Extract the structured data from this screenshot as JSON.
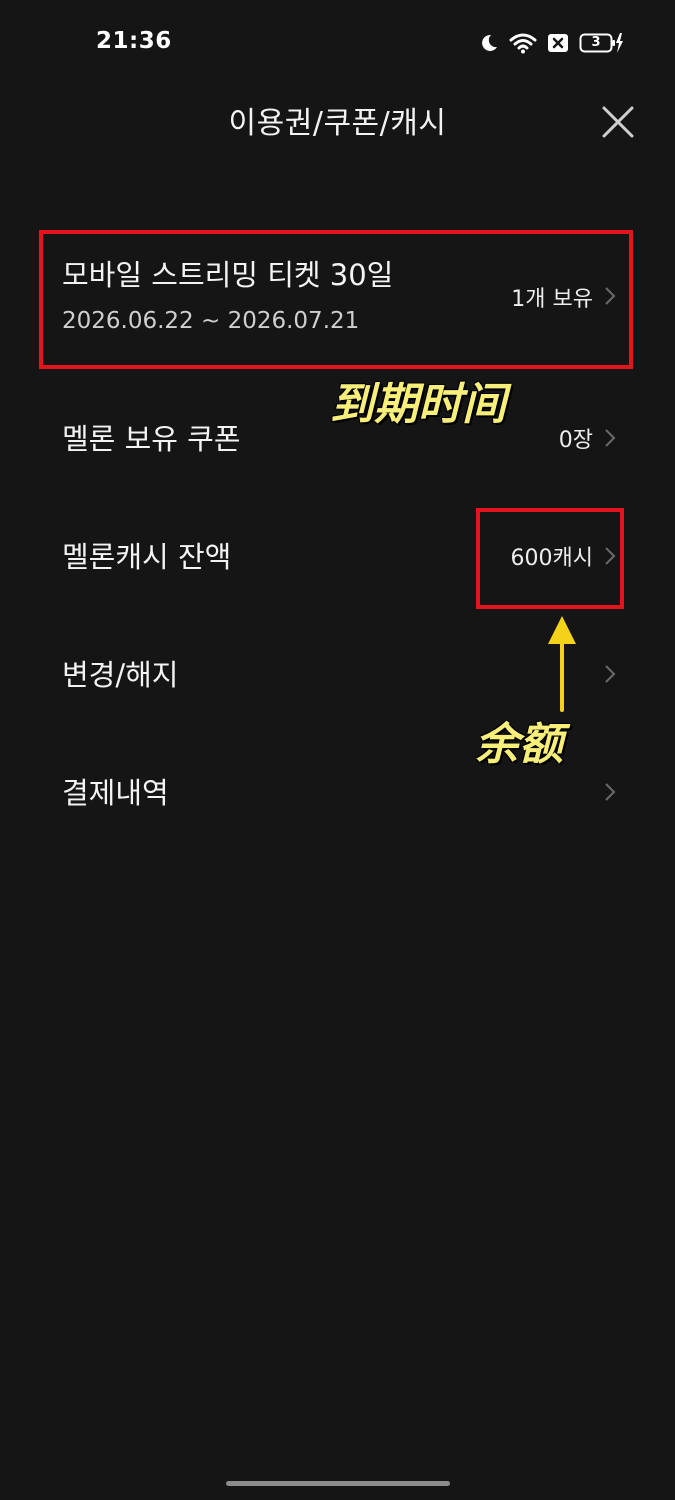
{
  "status_bar": {
    "time": "21:36",
    "battery_level": "3"
  },
  "header": {
    "title": "이용권/쿠폰/캐시"
  },
  "items": [
    {
      "label": "모바일 스트리밍 티켓 30일",
      "sub": "2026.06.22 ~ 2026.07.21",
      "value": "1개 보유"
    },
    {
      "label": "멜론 보유 쿠폰",
      "value": "0장"
    },
    {
      "label": "멜론캐시 잔액",
      "value": "600캐시"
    },
    {
      "label": "변경/해지",
      "value": ""
    },
    {
      "label": "결제내역",
      "value": ""
    }
  ],
  "annotations": {
    "expiry": "到期时间",
    "balance": "余额"
  },
  "colors": {
    "background": "#151515",
    "highlight_box": "#e3141b",
    "annotation_text": "#f7ef7a",
    "arrow": "#f5d21a"
  }
}
